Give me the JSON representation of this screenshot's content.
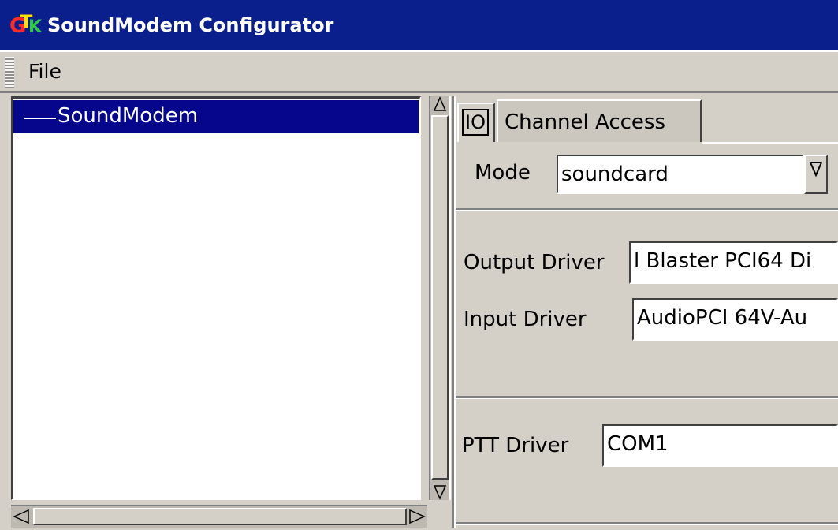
{
  "window": {
    "title": "SoundModem Configurator",
    "icon_letters": [
      "G",
      "T",
      "K"
    ]
  },
  "menu": {
    "file_label": "File"
  },
  "tree": {
    "items": [
      {
        "label": "SoundModem",
        "selected": true
      }
    ]
  },
  "tabs": [
    {
      "label": "IO",
      "active": true
    },
    {
      "label": "Channel Access",
      "active": false
    }
  ],
  "io": {
    "mode_label": "Mode",
    "mode_value": "soundcard",
    "output_driver_label": "Output Driver",
    "output_driver_value": "l Blaster PCI64 Di",
    "input_driver_label": "Input Driver",
    "input_driver_value": "AudioPCI 64V-Au",
    "ptt_driver_label": "PTT Driver",
    "ptt_driver_value": "COM1"
  },
  "icons": {
    "combo_arrow": "chevron-down-icon",
    "scroll_up": "arrow-up-icon",
    "scroll_down": "arrow-down-icon",
    "scroll_left": "arrow-left-icon",
    "scroll_right": "arrow-right-icon"
  },
  "colors": {
    "titlebar": "#0a1f8c",
    "selection": "#06068c",
    "window_bg": "#d4d0c8"
  }
}
